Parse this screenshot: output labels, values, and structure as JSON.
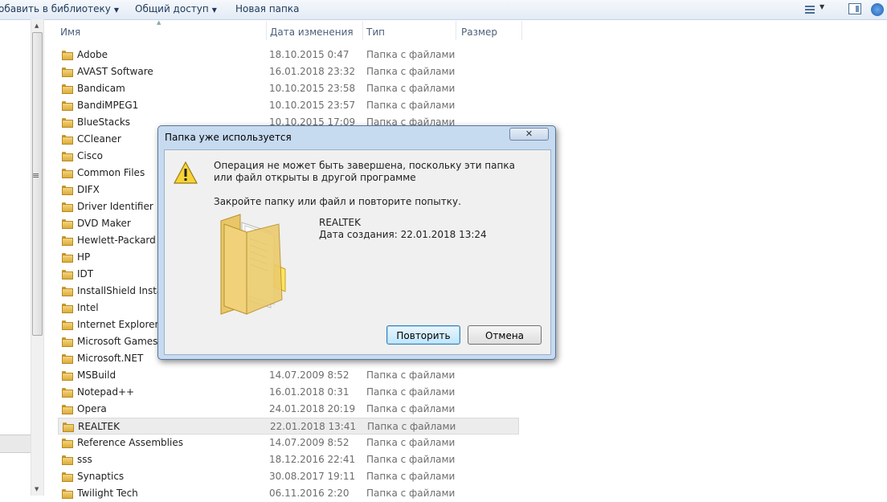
{
  "toolbar": {
    "add_to_library": "обавить в библиотеку",
    "share": "Общий доступ",
    "new_folder": "Новая папка"
  },
  "columns": {
    "name": "Имя",
    "date": "Дата изменения",
    "type": "Тип",
    "size": "Размер"
  },
  "files": [
    {
      "name": "Adobe",
      "date": "18.10.2015 0:47",
      "type": "Папка с файлами"
    },
    {
      "name": "AVAST Software",
      "date": "16.01.2018 23:32",
      "type": "Папка с файлами"
    },
    {
      "name": "Bandicam",
      "date": "10.10.2015 23:58",
      "type": "Папка с файлами"
    },
    {
      "name": "BandiMPEG1",
      "date": "10.10.2015 23:57",
      "type": "Папка с файлами"
    },
    {
      "name": "BlueStacks",
      "date": "10.10.2015 17:09",
      "type": "Папка с файлами"
    },
    {
      "name": "CCleaner",
      "date": "",
      "type": ""
    },
    {
      "name": "Cisco",
      "date": "",
      "type": ""
    },
    {
      "name": "Common Files",
      "date": "",
      "type": ""
    },
    {
      "name": "DIFX",
      "date": "",
      "type": ""
    },
    {
      "name": "Driver Identifier",
      "date": "",
      "type": ""
    },
    {
      "name": "DVD Maker",
      "date": "",
      "type": ""
    },
    {
      "name": "Hewlett-Packard",
      "date": "",
      "type": ""
    },
    {
      "name": "HP",
      "date": "",
      "type": ""
    },
    {
      "name": "IDT",
      "date": "",
      "type": ""
    },
    {
      "name": "InstallShield Installa",
      "date": "",
      "type": ""
    },
    {
      "name": "Intel",
      "date": "",
      "type": ""
    },
    {
      "name": "Internet Explorer",
      "date": "",
      "type": ""
    },
    {
      "name": "Microsoft Games",
      "date": "",
      "type": ""
    },
    {
      "name": "Microsoft.NET",
      "date": "",
      "type": ""
    },
    {
      "name": "MSBuild",
      "date": "14.07.2009 8:52",
      "type": "Папка с файлами"
    },
    {
      "name": "Notepad++",
      "date": "16.01.2018 0:31",
      "type": "Папка с файлами"
    },
    {
      "name": "Opera",
      "date": "24.01.2018 20:19",
      "type": "Папка с файлами"
    },
    {
      "name": "REALTEK",
      "date": "22.01.2018 13:41",
      "type": "Папка с файлами",
      "selected": true
    },
    {
      "name": "Reference Assemblies",
      "date": "14.07.2009 8:52",
      "type": "Папка с файлами"
    },
    {
      "name": "sss",
      "date": "18.12.2016 22:41",
      "type": "Папка с файлами"
    },
    {
      "name": "Synaptics",
      "date": "30.08.2017 19:11",
      "type": "Папка с файлами"
    },
    {
      "name": "Twilight Tech",
      "date": "06.11.2016 2:20",
      "type": "Папка с файлами"
    }
  ],
  "dialog": {
    "title": "Папка уже используется",
    "close_label": "✕",
    "message": "Операция не может быть завершена, поскольку эти папка или файл открыты в другой программе",
    "hint": "Закройте папку или файл и повторите попытку.",
    "file_name": "REALTEK",
    "file_date": "Дата создания: 22.01.2018 13:24",
    "retry_label": "Повторить",
    "cancel_label": "Отмена"
  },
  "icons": {
    "folder": "folder-icon",
    "warning": "warning-icon"
  }
}
